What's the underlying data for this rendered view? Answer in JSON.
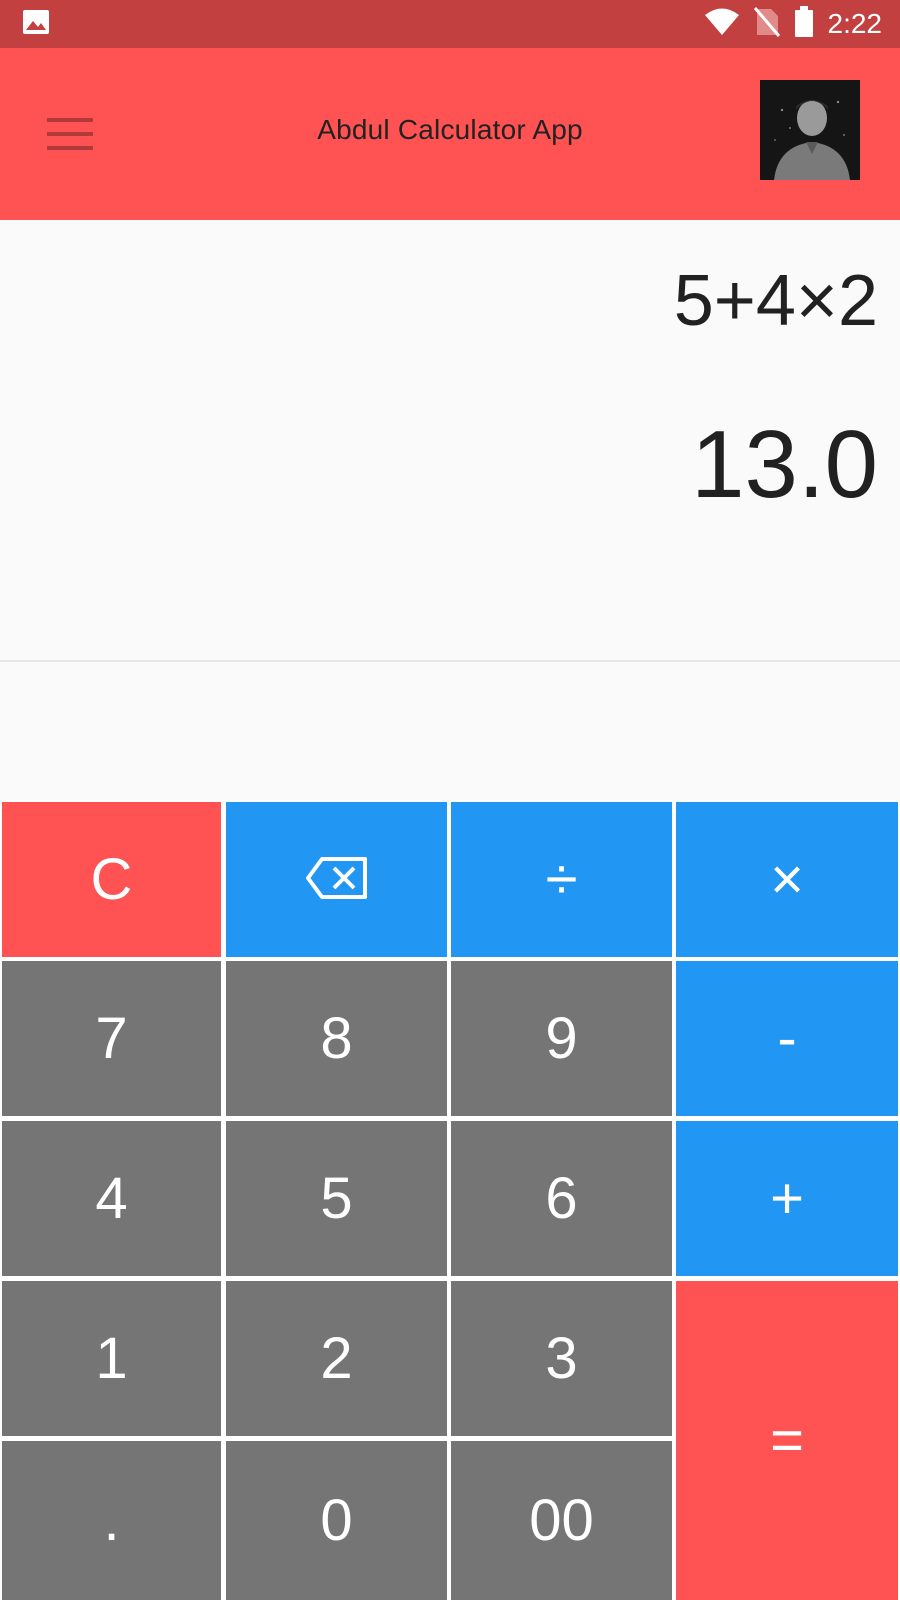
{
  "status_bar": {
    "time": "2:22",
    "icons": [
      "image-icon",
      "wifi-icon",
      "no-sim-icon",
      "battery-icon"
    ]
  },
  "app_bar": {
    "title": "Abdul Calculator App",
    "menu_icon": "menu-icon",
    "avatar": "profile-avatar"
  },
  "display": {
    "expression": "5+4×2",
    "result": "13.0"
  },
  "keypad": {
    "clear": "C",
    "backspace_icon": "backspace-icon",
    "divide": "÷",
    "multiply": "×",
    "seven": "7",
    "eight": "8",
    "nine": "9",
    "minus": "-",
    "four": "4",
    "five": "5",
    "six": "6",
    "plus": "+",
    "one": "1",
    "two": "2",
    "three": "3",
    "equals": "=",
    "dot": ".",
    "zero": "0",
    "double_zero": "00"
  },
  "colors": {
    "status_bar": "#c24040",
    "app_bar": "#ff5252",
    "operator": "#2196f3",
    "digit": "#757575",
    "accent": "#ff5252"
  }
}
